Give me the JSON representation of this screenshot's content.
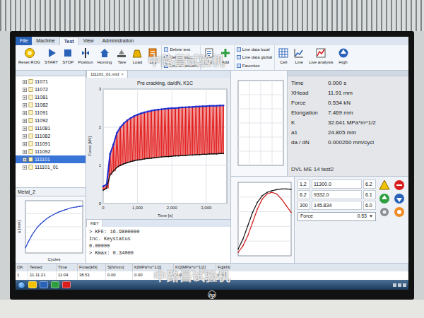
{
  "menu_tabs": [
    {
      "label": "File",
      "selected": false
    },
    {
      "label": "Machine",
      "selected": false
    },
    {
      "label": "Test",
      "selected": true
    },
    {
      "label": "View",
      "selected": false
    },
    {
      "label": "Administration",
      "selected": false
    }
  ],
  "ribbon": [
    {
      "label": "Reset ROG",
      "kind": "big"
    },
    {
      "label": "START",
      "kind": "big"
    },
    {
      "label": "STOP",
      "kind": "big"
    },
    {
      "label": "Position",
      "kind": "big"
    },
    {
      "label": "Homing",
      "kind": "big"
    },
    {
      "label": "Tare",
      "kind": "big"
    },
    {
      "label": "Load",
      "kind": "big"
    },
    {
      "label": "Log",
      "kind": "big"
    },
    {
      "label": "Delete test",
      "kind": "small"
    },
    {
      "label": "Delete rows",
      "kind": "small"
    },
    {
      "label": "End of session",
      "kind": "small"
    },
    {
      "label": "Result",
      "kind": "big"
    },
    {
      "label": "Add",
      "kind": "big"
    },
    {
      "label": "Line data local",
      "kind": "small"
    },
    {
      "label": "Line data global",
      "kind": "small"
    },
    {
      "label": "Favorites",
      "kind": "small"
    },
    {
      "label": "Cell",
      "kind": "big"
    },
    {
      "label": "Line",
      "kind": "big"
    },
    {
      "label": "Live analysis",
      "kind": "big"
    },
    {
      "label": "High",
      "kind": "big"
    }
  ],
  "documents": [
    {
      "label": "111101_01.mtd",
      "close": "×",
      "selected": true
    }
  ],
  "tree": {
    "items": [
      {
        "label": "11071",
        "selected": false
      },
      {
        "label": "11072",
        "selected": false
      },
      {
        "label": "11081",
        "selected": false
      },
      {
        "label": "11082",
        "selected": false
      },
      {
        "label": "11091",
        "selected": false
      },
      {
        "label": "11092",
        "selected": false
      },
      {
        "label": "111081",
        "selected": false
      },
      {
        "label": "111082",
        "selected": false
      },
      {
        "label": "111091",
        "selected": false
      },
      {
        "label": "111092",
        "selected": false
      },
      {
        "label": "111101",
        "selected": true
      },
      {
        "label": "111101_01",
        "selected": false
      }
    ],
    "footer": "Metal_2"
  },
  "main_chart": {
    "title": "Pre cracking, da/dN, K1C",
    "y_label": "Force [kN]",
    "x_label": "Time [s]",
    "y_ticks": [
      {
        "label": "0",
        "value": 0
      },
      {
        "label": "1",
        "value": 1
      },
      {
        "label": "2",
        "value": 2
      },
      {
        "label": "3",
        "value": 3
      }
    ],
    "x_ticks": [
      {
        "label": "0",
        "value": 0
      },
      {
        "label": "1,000",
        "value": 1000
      },
      {
        "label": "2,000",
        "value": 2000
      },
      {
        "label": "3,000",
        "value": 3000
      }
    ],
    "time": [
      0,
      100,
      200,
      300,
      400,
      500,
      600,
      700,
      800,
      900,
      1000,
      1100,
      1200,
      1300,
      1400,
      1500,
      1600,
      1700,
      1800,
      1900,
      2000,
      2100,
      2200,
      2300,
      2400,
      2500,
      2600,
      2700,
      2800,
      2900,
      3000,
      3100,
      3200,
      3300,
      3400,
      3500
    ],
    "upper": [
      0.45,
      0.5,
      1.3,
      1.55,
      1.85,
      2.0,
      2.1,
      2.18,
      2.24,
      2.29,
      2.33,
      2.36,
      2.39,
      2.41,
      2.43,
      2.45,
      2.46,
      2.47,
      2.48,
      2.49,
      2.5,
      2.5,
      2.51,
      2.52,
      2.52,
      2.53,
      2.53,
      2.54,
      2.54,
      2.55,
      2.55,
      2.56,
      2.56,
      2.56,
      2.57,
      2.57
    ],
    "lower": [
      0.35,
      0.4,
      0.75,
      0.85,
      0.95,
      1.0,
      1.04,
      1.07,
      1.1,
      1.12,
      1.14,
      1.15,
      1.17,
      1.18,
      1.19,
      1.2,
      1.21,
      1.22,
      1.23,
      1.23,
      1.24,
      1.25,
      1.25,
      1.26,
      1.26,
      1.27,
      1.27,
      1.28,
      1.28,
      1.29,
      1.29,
      1.3,
      1.3,
      1.3,
      1.31,
      1.31
    ],
    "upper_color": "#1f2fd0",
    "lower_color": "#111111",
    "cycle_color": "#e01414"
  },
  "left_chart": {
    "x_label": "Cycles",
    "y_label": "a [mm]",
    "color": "#1f3fd0",
    "values": [
      24.1,
      24.22,
      24.33,
      24.42,
      24.5,
      24.56,
      24.61,
      24.66,
      24.7,
      24.73,
      24.76,
      24.79,
      24.81,
      24.83,
      24.85,
      24.87,
      24.88,
      24.89,
      24.9,
      24.91
    ]
  },
  "bottom_chart": {
    "series": [
      {
        "color": "#111111",
        "values": [
          0.2,
          0.5,
          0.9,
          1.3,
          1.6,
          1.8,
          1.9,
          1.95,
          1.98,
          2.0,
          2.0,
          1.99
        ]
      },
      {
        "color": "#d01818",
        "values": [
          0.1,
          0.3,
          0.6,
          1.0,
          1.4,
          1.7,
          1.85,
          1.9,
          1.85,
          1.7,
          1.5,
          1.3
        ]
      }
    ]
  },
  "log": {
    "tab": "KEY",
    "lines": [
      "> KFE: 16.9800000",
      "Inc. Keystatus",
      "0.00000",
      "> Kmax: 0.34000"
    ]
  },
  "readouts": {
    "rows": [
      {
        "label": "Time",
        "value": "0.000 s"
      },
      {
        "label": "XHead",
        "value": "11.91 mm"
      },
      {
        "label": "Force",
        "value": "0.534 kN"
      },
      {
        "label": "Elongation",
        "value": "7.469 mm"
      },
      {
        "label": "K",
        "value": "32.641 MPa*m^1/2"
      },
      {
        "label": "a1",
        "value": "24.805 mm"
      },
      {
        "label": "da / dN",
        "value": "0.000260 mm/cycl"
      }
    ],
    "footer": "DVL ME 14 test2"
  },
  "controls": {
    "rows": [
      [
        "1.2",
        "11300.0",
        "6.2"
      ],
      [
        "6.2",
        "9332.0",
        "6.1"
      ],
      [
        "300",
        "145.834",
        "6.0"
      ]
    ],
    "channel": {
      "label": "Force",
      "value": "0.53"
    }
  },
  "table": {
    "columns": [
      "OK",
      "Tested",
      "Time",
      "Fmax[kN]",
      "S[N/mm]",
      "K[MPa*m^1/2]",
      "KQ[MPa*m^1/2]",
      "Fq[kN]"
    ],
    "rows": [
      [
        "1",
        "11.11.21",
        "11:04",
        "38.51",
        "0.00",
        "0.00",
        "0.00",
        "0.00"
      ]
    ]
  },
  "watermarks": [
    "中路昌试验机",
    "中路昌试验机"
  ],
  "monitor": {
    "logo": "hp"
  }
}
